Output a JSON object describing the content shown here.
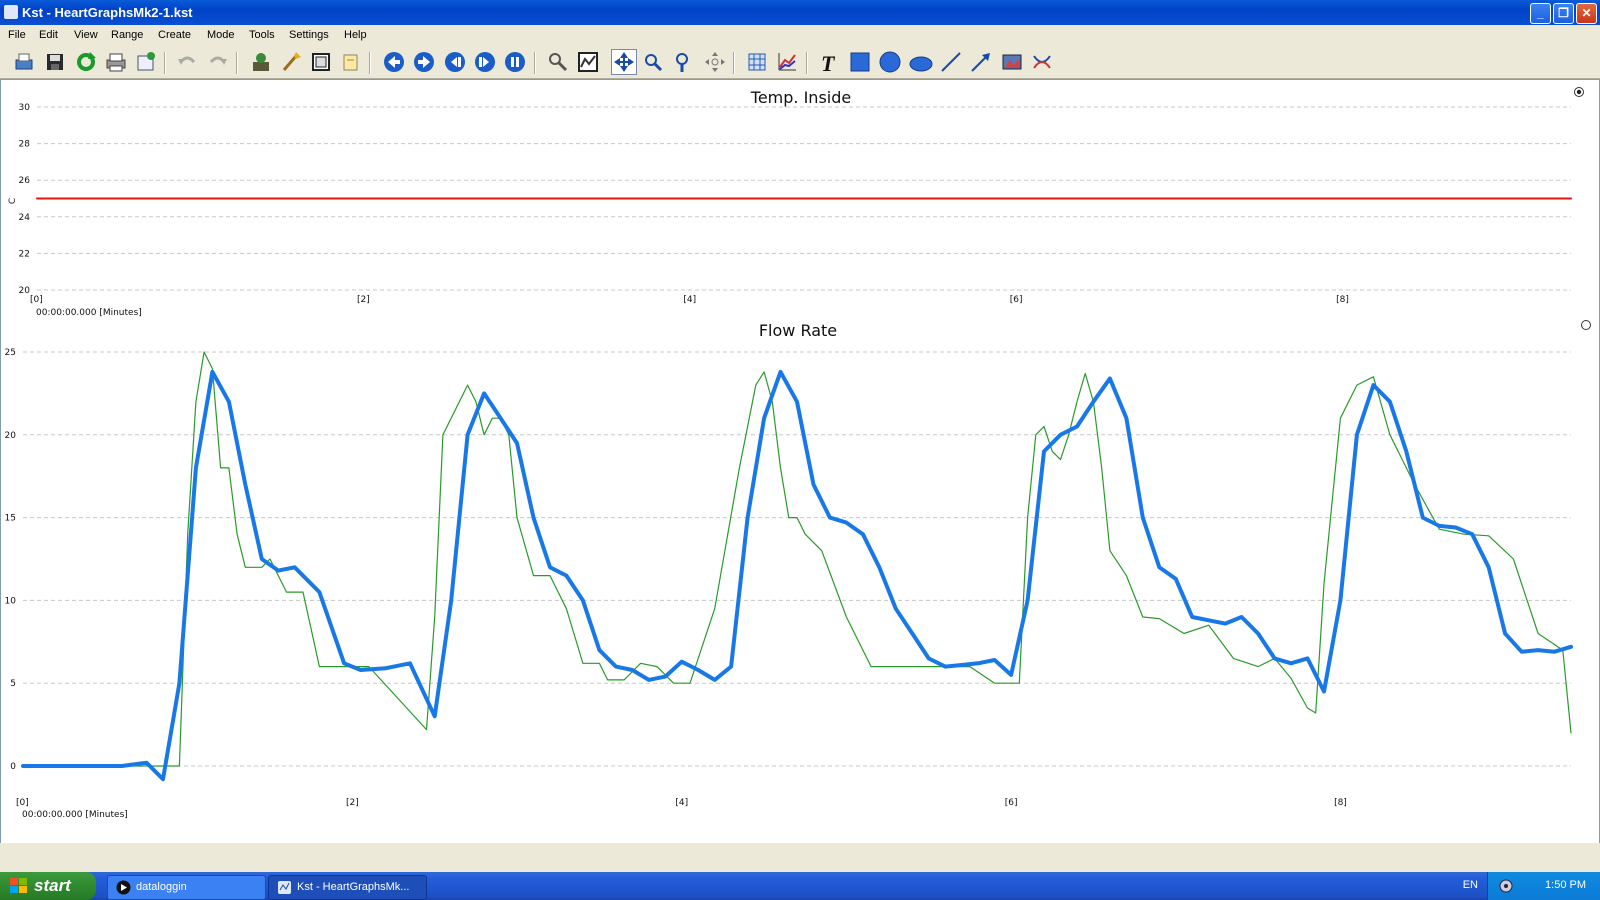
{
  "window": {
    "title": "Kst - HeartGraphsMk2-1.kst"
  },
  "menu": [
    "File",
    "Edit",
    "View",
    "Range",
    "Create",
    "Mode",
    "Tools",
    "Settings",
    "Help"
  ],
  "toolbar": {
    "icons": [
      "print-preview-icon",
      "save-icon",
      "reload-icon",
      "print-icon",
      "export-icon",
      "undo-icon",
      "redo-icon",
      "data-manager-icon",
      "data-wizard-icon",
      "plot-icon",
      "edit-icon",
      "back-icon",
      "forward-icon",
      "first-icon",
      "last-icon",
      "pause-icon",
      "zoom-layout-icon",
      "xy-zoom-icon",
      "zoom-mode-icon",
      "zoom-x-icon",
      "zoom-y-icon",
      "pan-icon",
      "grid-icon",
      "curve-icon",
      "text-icon",
      "box-icon",
      "circle-icon",
      "ellipse-icon",
      "line-icon",
      "arrow-icon",
      "picture-icon",
      "shared-axis-icon"
    ]
  },
  "plot1": {
    "title": "Temp. Inside",
    "ylabel": "C",
    "xref": "00:00:00.000 [Minutes]"
  },
  "plot2": {
    "title": "Flow Rate",
    "xref": "00:00:00.000 [Minutes]"
  },
  "chart_data": [
    {
      "type": "line",
      "title": "Temp. Inside",
      "ylabel": "C",
      "ylim": [
        20,
        30
      ],
      "xlim": [
        0,
        9.4
      ],
      "yticks": [
        "20",
        "22",
        "24",
        "26",
        "28",
        "30"
      ],
      "xticks": [
        "[0]",
        "[2]",
        "[4]",
        "[6]",
        "[8]"
      ],
      "grid": true,
      "series": [
        {
          "color": "#e8150f",
          "x": [
            0,
            9.4
          ],
          "y": [
            25,
            25
          ]
        }
      ]
    },
    {
      "type": "line",
      "title": "Flow Rate",
      "ylim": [
        0,
        25
      ],
      "xlim": [
        0,
        9.4
      ],
      "yticks": [
        "0",
        "5",
        "10",
        "15",
        "20",
        "25"
      ],
      "xticks": [
        "[0]",
        "[2]",
        "[4]",
        "[6]",
        "[8]"
      ],
      "grid": true,
      "series": [
        {
          "color": "#1878e8",
          "x": [
            0,
            0.3,
            0.6,
            0.75,
            0.85,
            0.95,
            1.05,
            1.15,
            1.25,
            1.35,
            1.45,
            1.55,
            1.65,
            1.8,
            1.95,
            2.05,
            2.2,
            2.35,
            2.5,
            2.6,
            2.7,
            2.8,
            2.9,
            3.0,
            3.1,
            3.2,
            3.3,
            3.4,
            3.5,
            3.6,
            3.7,
            3.8,
            3.9,
            4.0,
            4.1,
            4.2,
            4.3,
            4.4,
            4.5,
            4.6,
            4.7,
            4.8,
            4.9,
            5.0,
            5.1,
            5.2,
            5.3,
            5.4,
            5.5,
            5.6,
            5.7,
            5.8,
            5.9,
            6.0,
            6.1,
            6.2,
            6.3,
            6.4,
            6.5,
            6.6,
            6.7,
            6.8,
            6.9,
            7.0,
            7.1,
            7.2,
            7.3,
            7.4,
            7.5,
            7.6,
            7.7,
            7.8,
            7.9,
            8.0,
            8.1,
            8.2,
            8.3,
            8.4,
            8.5,
            8.6,
            8.7,
            8.8,
            8.9,
            9.0,
            9.1,
            9.2,
            9.3,
            9.4
          ],
          "y": [
            0,
            0,
            0,
            0.2,
            -0.8,
            5,
            18,
            23.8,
            22,
            17,
            12.5,
            11.8,
            12,
            10.5,
            6.2,
            5.8,
            5.9,
            6.2,
            3,
            10,
            20,
            22.5,
            21,
            19.5,
            15,
            12,
            11.5,
            10,
            7,
            6,
            5.8,
            5.2,
            5.4,
            6.3,
            5.8,
            5.2,
            6,
            15,
            21,
            23.8,
            22,
            17,
            15,
            14.7,
            14,
            12,
            9.5,
            8,
            6.5,
            6,
            6.1,
            6.2,
            6.4,
            5.5,
            10,
            19,
            20,
            20.5,
            22,
            23.4,
            21,
            15,
            12,
            11.3,
            9,
            8.8,
            8.6,
            9,
            8,
            6.5,
            6.2,
            6.5,
            4.5,
            10,
            20,
            23,
            22,
            19,
            15,
            14.5,
            14.4,
            14,
            12,
            8,
            6.9,
            7,
            6.9,
            7.2
          ]
        },
        {
          "color": "#2a9a2a",
          "x": [
            0,
            0.95,
            1.0,
            1.05,
            1.1,
            1.15,
            1.2,
            1.25,
            1.3,
            1.35,
            1.4,
            1.45,
            1.5,
            1.6,
            1.7,
            1.8,
            2.0,
            2.1,
            2.45,
            2.5,
            2.55,
            2.7,
            2.75,
            2.8,
            2.85,
            2.9,
            2.95,
            3.0,
            3.1,
            3.2,
            3.3,
            3.4,
            3.5,
            3.55,
            3.65,
            3.75,
            3.85,
            3.95,
            4.05,
            4.2,
            4.35,
            4.45,
            4.5,
            4.55,
            4.6,
            4.65,
            4.7,
            4.75,
            4.85,
            5.0,
            5.15,
            5.3,
            5.45,
            5.6,
            5.75,
            5.9,
            6.05,
            6.1,
            6.15,
            6.2,
            6.25,
            6.3,
            6.35,
            6.4,
            6.45,
            6.5,
            6.55,
            6.6,
            6.7,
            6.8,
            6.9,
            7.05,
            7.2,
            7.35,
            7.5,
            7.6,
            7.7,
            7.8,
            7.85,
            7.9,
            8.0,
            8.1,
            8.2,
            8.3,
            8.45,
            8.6,
            8.75,
            8.9,
            9.05,
            9.2,
            9.35,
            9.4
          ],
          "y": [
            0,
            0,
            14,
            22,
            25,
            24,
            18,
            18,
            14,
            12,
            12,
            12,
            12.5,
            10.5,
            10.5,
            6,
            6,
            6,
            2.2,
            9,
            20,
            23,
            22,
            20,
            21,
            21,
            20,
            15,
            11.5,
            11.5,
            9.5,
            6.2,
            6.2,
            5.2,
            5.2,
            6.2,
            6,
            5,
            5,
            9.5,
            18,
            23,
            23.8,
            22,
            18,
            15,
            15,
            14,
            13,
            9,
            6,
            6,
            6,
            6,
            6,
            5,
            5,
            15,
            20,
            20.5,
            19,
            18.5,
            20,
            22,
            23.7,
            22,
            18,
            13,
            11.5,
            9,
            8.9,
            8,
            8.5,
            6.5,
            6,
            6.5,
            5.3,
            3.5,
            3.2,
            11,
            21,
            23,
            23.5,
            20,
            17,
            14.3,
            14,
            13.9,
            12.5,
            8,
            7,
            2
          ]
        }
      ]
    }
  ],
  "taskbar": {
    "start": "start",
    "tasks": [
      "dataloggin",
      "Kst - HeartGraphsMk..."
    ],
    "lang": "EN",
    "clock": "1:50 PM"
  }
}
